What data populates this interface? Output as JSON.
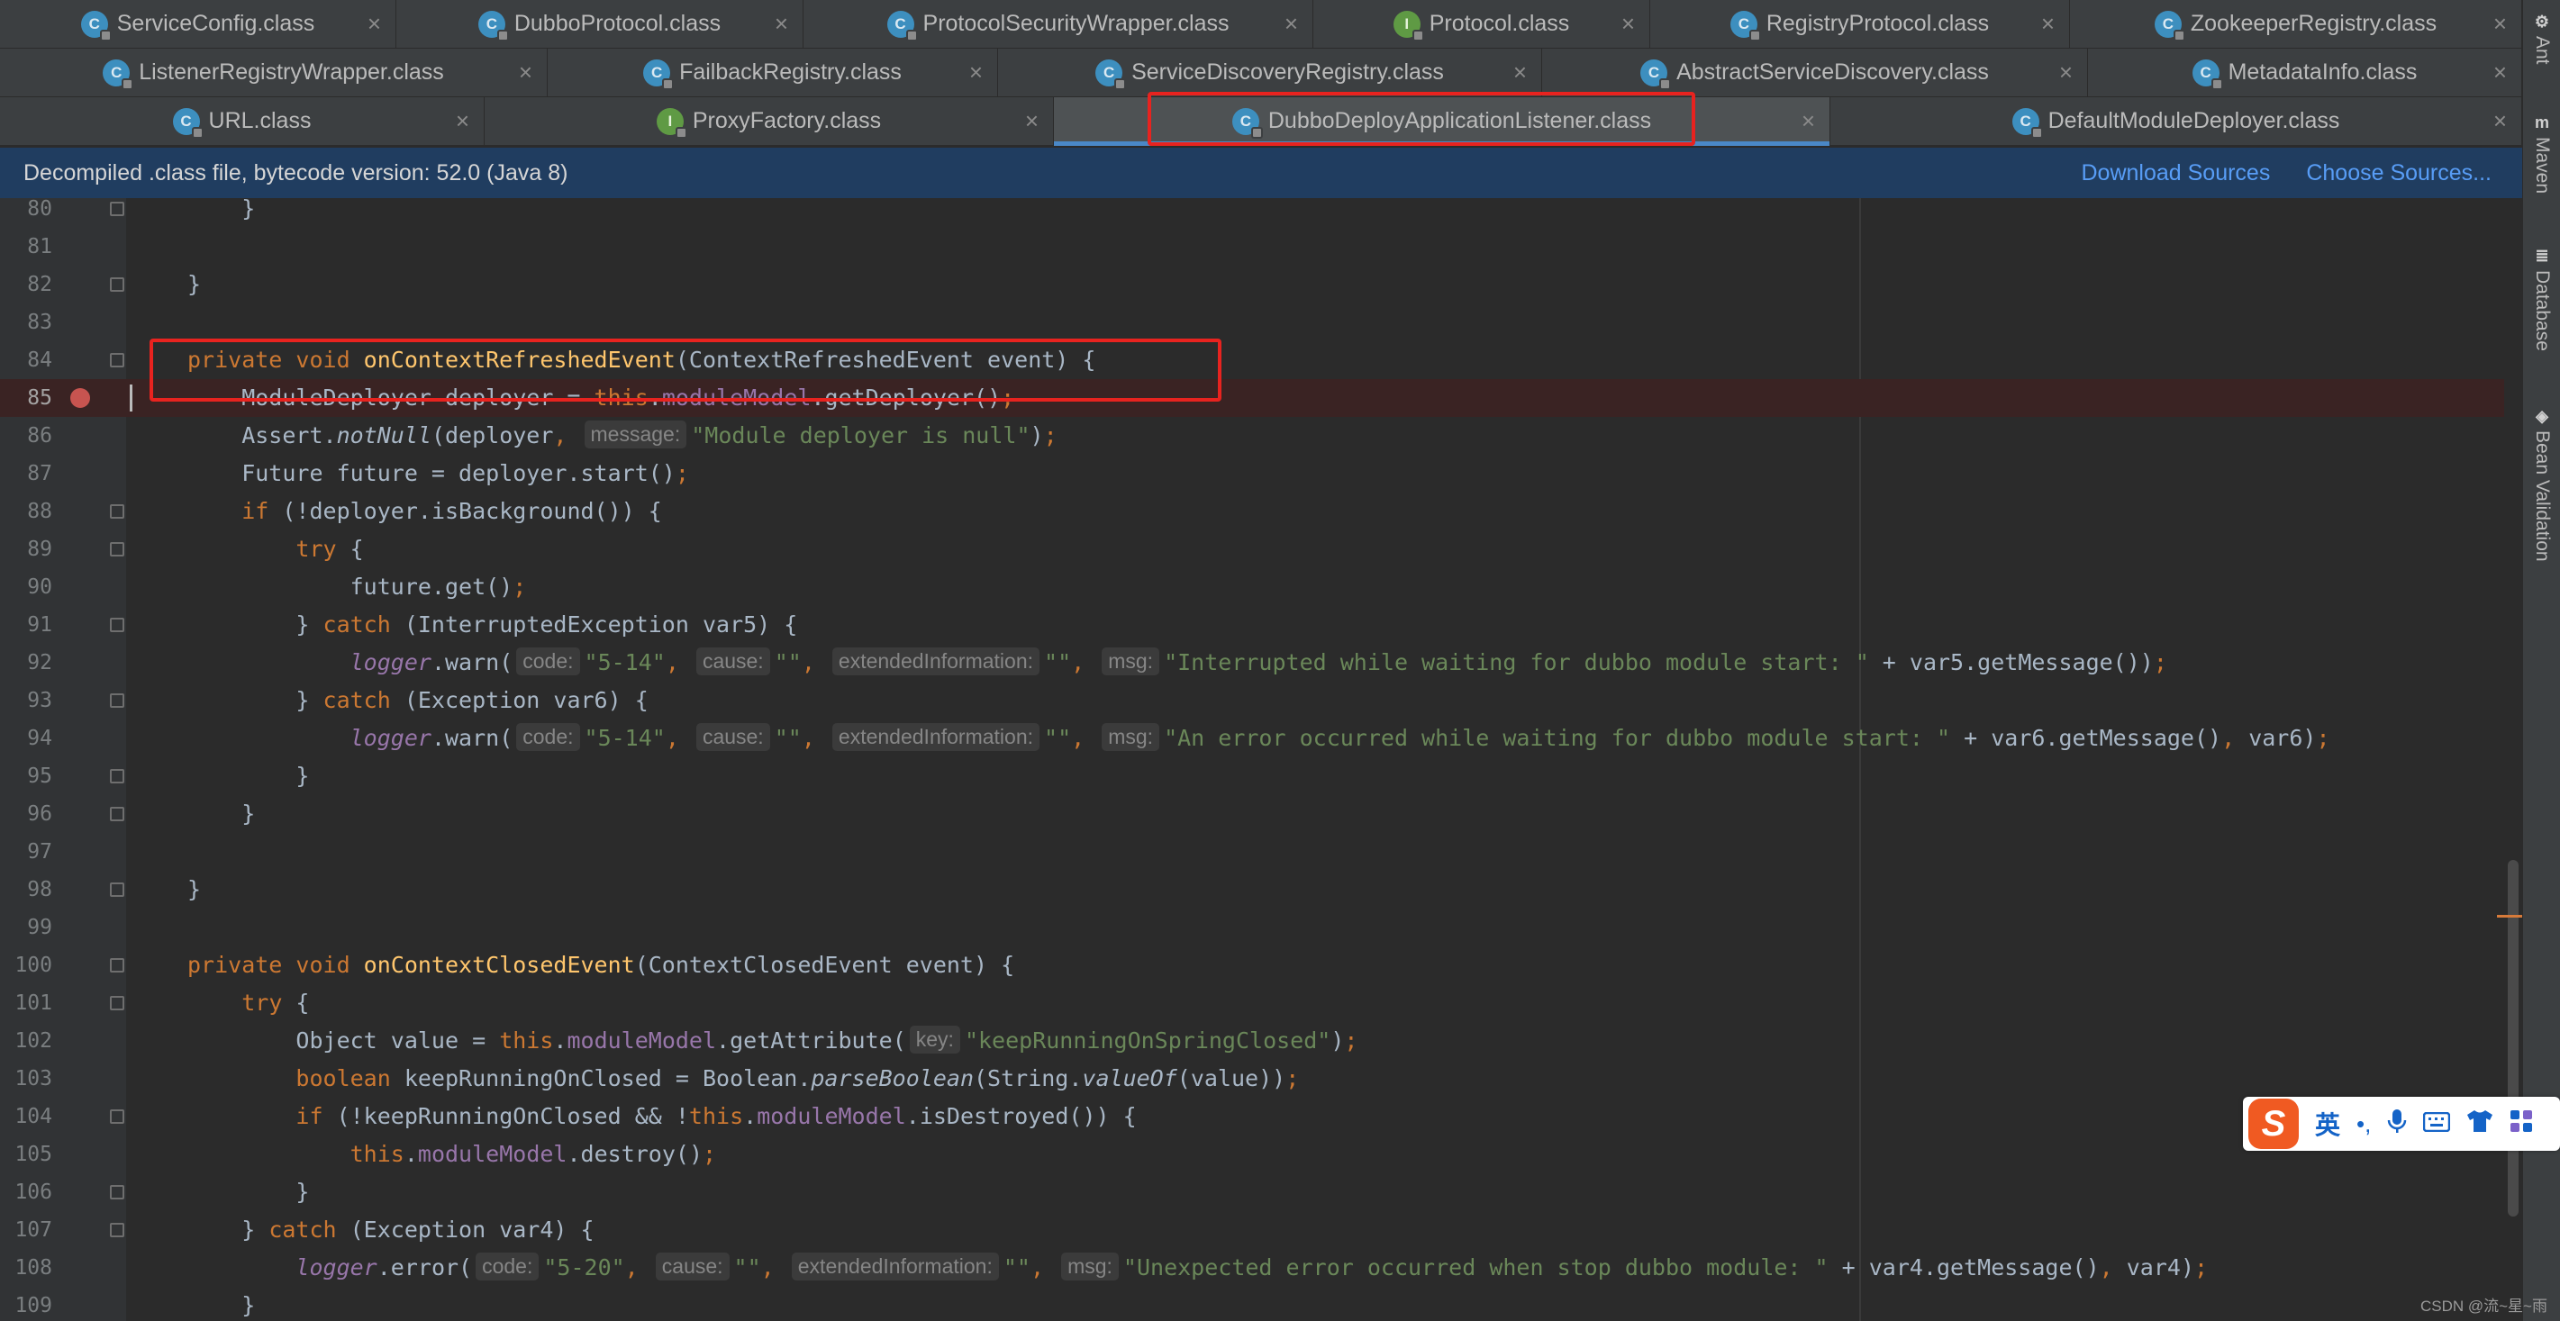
{
  "tabs": {
    "rows": [
      [
        {
          "label": "ServiceConfig.class",
          "icon": "class-icon",
          "active": false
        },
        {
          "label": "DubboProtocol.class",
          "icon": "class-icon",
          "active": false
        },
        {
          "label": "ProtocolSecurityWrapper.class",
          "icon": "class-icon",
          "active": false
        },
        {
          "label": "Protocol.class",
          "icon": "interface-icon",
          "active": false
        },
        {
          "label": "RegistryProtocol.class",
          "icon": "class-icon",
          "active": false
        },
        {
          "label": "ZookeeperRegistry.class",
          "icon": "class-icon",
          "active": false
        }
      ],
      [
        {
          "label": "ListenerRegistryWrapper.class",
          "icon": "class-icon",
          "active": false
        },
        {
          "label": "FailbackRegistry.class",
          "icon": "class-icon",
          "active": false
        },
        {
          "label": "ServiceDiscoveryRegistry.class",
          "icon": "class-icon",
          "active": false
        },
        {
          "label": "AbstractServiceDiscovery.class",
          "icon": "class-icon",
          "active": false
        },
        {
          "label": "MetadataInfo.class",
          "icon": "class-icon",
          "active": false
        }
      ],
      [
        {
          "label": "URL.class",
          "icon": "class-icon",
          "active": false
        },
        {
          "label": "ProxyFactory.class",
          "icon": "interface-icon",
          "active": false
        },
        {
          "label": "DubboDeployApplicationListener.class",
          "icon": "class-icon",
          "active": true
        },
        {
          "label": "DefaultModuleDeployer.class",
          "icon": "class-icon",
          "active": false
        }
      ]
    ],
    "close_glyph": "×"
  },
  "banner": {
    "text": "Decompiled .class file, bytecode version: 52.0 (Java 8)",
    "download_sources": "Download Sources",
    "choose_sources": "Choose Sources..."
  },
  "editor": {
    "current_line": 85,
    "breakpoint_line": 85,
    "lines": [
      {
        "n": 80,
        "fold": true,
        "tokens": [
          {
            "t": "    }"
          }
        ]
      },
      {
        "n": 81,
        "fold": false,
        "tokens": []
      },
      {
        "n": 82,
        "fold": true,
        "tokens": [
          {
            "t": "}"
          }
        ]
      },
      {
        "n": 83,
        "fold": false,
        "tokens": []
      },
      {
        "n": 84,
        "fold": true,
        "tokens": [
          {
            "t": "private void ",
            "c": "kw"
          },
          {
            "t": "onContextRefreshedEvent",
            "c": "fn"
          },
          {
            "t": "(ContextRefreshedEvent event) {"
          }
        ]
      },
      {
        "n": 85,
        "fold": false,
        "tokens": [
          {
            "t": "    ModuleDeployer deployer = "
          },
          {
            "t": "this",
            "c": "kw"
          },
          {
            "t": "."
          },
          {
            "t": "moduleModel",
            "c": "fld"
          },
          {
            "t": ".getDeployer()"
          },
          {
            "t": ";",
            "c": "kw"
          }
        ]
      },
      {
        "n": 86,
        "fold": false,
        "tokens": [
          {
            "t": "    Assert."
          },
          {
            "t": "notNull",
            "c": "it"
          },
          {
            "t": "(deployer"
          },
          {
            "t": ", ",
            "c": "kw"
          },
          {
            "hint": "message:"
          },
          {
            "t": "\"Module deployer is null\"",
            "c": "str"
          },
          {
            "t": ")"
          },
          {
            "t": ";",
            "c": "kw"
          }
        ]
      },
      {
        "n": 87,
        "fold": false,
        "tokens": [
          {
            "t": "    Future future = deployer.start()"
          },
          {
            "t": ";",
            "c": "kw"
          }
        ]
      },
      {
        "n": 88,
        "fold": true,
        "tokens": [
          {
            "t": "    "
          },
          {
            "t": "if",
            "c": "kw"
          },
          {
            "t": " (!deployer.isBackground()) {"
          }
        ]
      },
      {
        "n": 89,
        "fold": true,
        "tokens": [
          {
            "t": "        "
          },
          {
            "t": "try",
            "c": "kw"
          },
          {
            "t": " {"
          }
        ]
      },
      {
        "n": 90,
        "fold": false,
        "tokens": [
          {
            "t": "            future.get()"
          },
          {
            "t": ";",
            "c": "kw"
          }
        ]
      },
      {
        "n": 91,
        "fold": true,
        "tokens": [
          {
            "t": "        } "
          },
          {
            "t": "catch",
            "c": "kw"
          },
          {
            "t": " (InterruptedException var5) {"
          }
        ]
      },
      {
        "n": 92,
        "fold": false,
        "tokens": [
          {
            "t": "            "
          },
          {
            "t": "logger",
            "c": "logger"
          },
          {
            "t": ".warn("
          },
          {
            "hint": "code:"
          },
          {
            "t": "\"5-14\"",
            "c": "str"
          },
          {
            "t": ", ",
            "c": "kw"
          },
          {
            "hint": "cause:"
          },
          {
            "t": "\"\"",
            "c": "str"
          },
          {
            "t": ", ",
            "c": "kw"
          },
          {
            "hint": "extendedInformation:"
          },
          {
            "t": "\"\"",
            "c": "str"
          },
          {
            "t": ", ",
            "c": "kw"
          },
          {
            "hint": "msg:"
          },
          {
            "t": "\"Interrupted while waiting for dubbo module start: \"",
            "c": "str"
          },
          {
            "t": " + var5.getMessage())"
          },
          {
            "t": ";",
            "c": "kw"
          }
        ]
      },
      {
        "n": 93,
        "fold": true,
        "tokens": [
          {
            "t": "        } "
          },
          {
            "t": "catch",
            "c": "kw"
          },
          {
            "t": " (Exception var6) {"
          }
        ]
      },
      {
        "n": 94,
        "fold": false,
        "tokens": [
          {
            "t": "            "
          },
          {
            "t": "logger",
            "c": "logger"
          },
          {
            "t": ".warn("
          },
          {
            "hint": "code:"
          },
          {
            "t": "\"5-14\"",
            "c": "str"
          },
          {
            "t": ", ",
            "c": "kw"
          },
          {
            "hint": "cause:"
          },
          {
            "t": "\"\"",
            "c": "str"
          },
          {
            "t": ", ",
            "c": "kw"
          },
          {
            "hint": "extendedInformation:"
          },
          {
            "t": "\"\"",
            "c": "str"
          },
          {
            "t": ", ",
            "c": "kw"
          },
          {
            "hint": "msg:"
          },
          {
            "t": "\"An error occurred while waiting for dubbo module start: \"",
            "c": "str"
          },
          {
            "t": " + var6.getMessage()"
          },
          {
            "t": ", ",
            "c": "kw"
          },
          {
            "t": "var6)"
          },
          {
            "t": ";",
            "c": "kw"
          }
        ]
      },
      {
        "n": 95,
        "fold": true,
        "tokens": [
          {
            "t": "        }"
          }
        ]
      },
      {
        "n": 96,
        "fold": true,
        "tokens": [
          {
            "t": "    }"
          }
        ]
      },
      {
        "n": 97,
        "fold": false,
        "tokens": []
      },
      {
        "n": 98,
        "fold": true,
        "tokens": [
          {
            "t": "}"
          }
        ]
      },
      {
        "n": 99,
        "fold": false,
        "tokens": []
      },
      {
        "n": 100,
        "fold": true,
        "tokens": [
          {
            "t": "private void ",
            "c": "kw"
          },
          {
            "t": "onContextClosedEvent",
            "c": "fn"
          },
          {
            "t": "(ContextClosedEvent event) {"
          }
        ]
      },
      {
        "n": 101,
        "fold": true,
        "tokens": [
          {
            "t": "    "
          },
          {
            "t": "try",
            "c": "kw"
          },
          {
            "t": " {"
          }
        ]
      },
      {
        "n": 102,
        "fold": false,
        "tokens": [
          {
            "t": "        Object value = "
          },
          {
            "t": "this",
            "c": "kw"
          },
          {
            "t": "."
          },
          {
            "t": "moduleModel",
            "c": "fld"
          },
          {
            "t": ".getAttribute("
          },
          {
            "hint": "key:"
          },
          {
            "t": "\"keepRunningOnSpringClosed\"",
            "c": "str"
          },
          {
            "t": ")"
          },
          {
            "t": ";",
            "c": "kw"
          }
        ]
      },
      {
        "n": 103,
        "fold": false,
        "tokens": [
          {
            "t": "        "
          },
          {
            "t": "boolean",
            "c": "kw"
          },
          {
            "t": " keepRunningOnClosed = Boolean."
          },
          {
            "t": "parseBoolean",
            "c": "it"
          },
          {
            "t": "(String."
          },
          {
            "t": "valueOf",
            "c": "it"
          },
          {
            "t": "(value))"
          },
          {
            "t": ";",
            "c": "kw"
          }
        ]
      },
      {
        "n": 104,
        "fold": true,
        "tokens": [
          {
            "t": "        "
          },
          {
            "t": "if",
            "c": "kw"
          },
          {
            "t": " (!keepRunningOnClosed && !"
          },
          {
            "t": "this",
            "c": "kw"
          },
          {
            "t": "."
          },
          {
            "t": "moduleModel",
            "c": "fld"
          },
          {
            "t": ".isDestroyed()) {"
          }
        ]
      },
      {
        "n": 105,
        "fold": false,
        "tokens": [
          {
            "t": "            "
          },
          {
            "t": "this",
            "c": "kw"
          },
          {
            "t": "."
          },
          {
            "t": "moduleModel",
            "c": "fld"
          },
          {
            "t": ".destroy()"
          },
          {
            "t": ";",
            "c": "kw"
          }
        ]
      },
      {
        "n": 106,
        "fold": true,
        "tokens": [
          {
            "t": "        }"
          }
        ]
      },
      {
        "n": 107,
        "fold": true,
        "tokens": [
          {
            "t": "    } "
          },
          {
            "t": "catch",
            "c": "kw"
          },
          {
            "t": " (Exception var4) {"
          }
        ]
      },
      {
        "n": 108,
        "fold": false,
        "tokens": [
          {
            "t": "        "
          },
          {
            "t": "logger",
            "c": "logger"
          },
          {
            "t": ".error("
          },
          {
            "hint": "code:"
          },
          {
            "t": "\"5-20\"",
            "c": "str"
          },
          {
            "t": ", ",
            "c": "kw"
          },
          {
            "hint": "cause:"
          },
          {
            "t": "\"\"",
            "c": "str"
          },
          {
            "t": ", ",
            "c": "kw"
          },
          {
            "hint": "extendedInformation:"
          },
          {
            "t": "\"\"",
            "c": "str"
          },
          {
            "t": ", ",
            "c": "kw"
          },
          {
            "hint": "msg:"
          },
          {
            "t": "\"Unexpected error occurred when stop dubbo module: \"",
            "c": "str"
          },
          {
            "t": " + var4.getMessage()"
          },
          {
            "t": ", ",
            "c": "kw"
          },
          {
            "t": "var4)"
          },
          {
            "t": ";",
            "c": "kw"
          }
        ]
      },
      {
        "n": 109,
        "fold": false,
        "tokens": [
          {
            "t": "    }"
          }
        ]
      }
    ]
  },
  "right_tools": [
    {
      "label": "Ant",
      "icon": "ant-icon",
      "glyph": "⚙"
    },
    {
      "label": "Maven",
      "icon": "maven-icon",
      "glyph": "m"
    },
    {
      "label": "Database",
      "icon": "database-icon",
      "glyph": "≣"
    },
    {
      "label": "Bean Validation",
      "icon": "bean-validation-icon",
      "glyph": "◈"
    }
  ],
  "ime": {
    "logo": "S",
    "lang": "英",
    "punct": "•,",
    "icons": [
      "microphone-icon",
      "keyboard-icon",
      "skin-icon",
      "toolbox-icon"
    ]
  },
  "watermark": "CSDN @流~星~雨",
  "colors": {
    "keyword": "#cc7832",
    "method_decl": "#ffc66d",
    "string": "#6a8759",
    "field": "#9876aa",
    "highlight": "#e8231f",
    "banner_bg": "#203d60",
    "link": "#589df6",
    "active_tab_underline": "#4a88c7"
  }
}
